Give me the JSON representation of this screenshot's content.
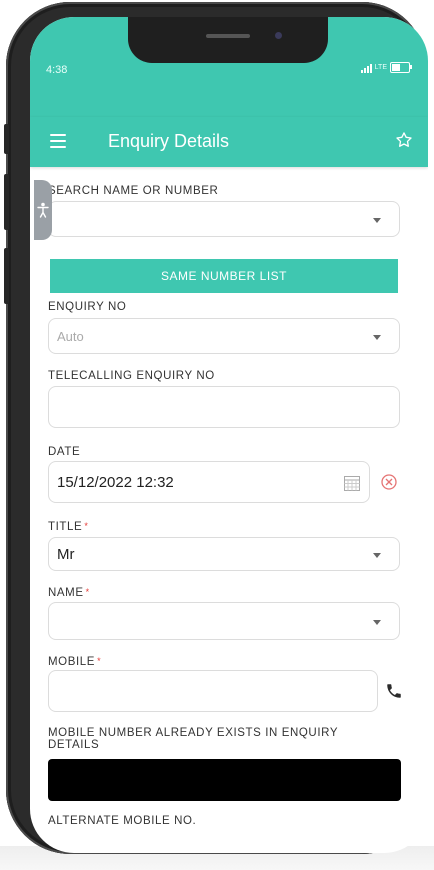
{
  "status_bar": {
    "time": "4:38",
    "network": "LTE",
    "battery_level": 0.6
  },
  "app_bar": {
    "title": "Enquiry Details",
    "menu_icon": "hamburger-menu-icon",
    "favorite_icon": "star-outline-icon"
  },
  "colors": {
    "accent": "#3fc7b0",
    "required": "#e53935",
    "clear": "#e57373"
  },
  "form": {
    "search": {
      "label": "SEARCH NAME OR NUMBER",
      "value": ""
    },
    "same_number_button": "SAME NUMBER LIST",
    "enquiry_no": {
      "label": "ENQUIRY NO",
      "placeholder": "Auto"
    },
    "telecalling_enquiry_no": {
      "label": "TELECALLING ENQUIRY NO",
      "value": ""
    },
    "date": {
      "label": "DATE",
      "value": "15/12/2022 12:32"
    },
    "title": {
      "label": "TITLE",
      "required_mark": "*",
      "value": "Mr"
    },
    "name": {
      "label": "NAME",
      "required_mark": "*",
      "value": ""
    },
    "mobile": {
      "label": "MOBILE",
      "required_mark": "*",
      "value": ""
    },
    "mobile_exists_notice": "MOBILE NUMBER ALREADY EXISTS IN ENQUIRY DETAILS",
    "alternate_mobile": {
      "label": "ALTERNATE MOBILE NO."
    }
  }
}
